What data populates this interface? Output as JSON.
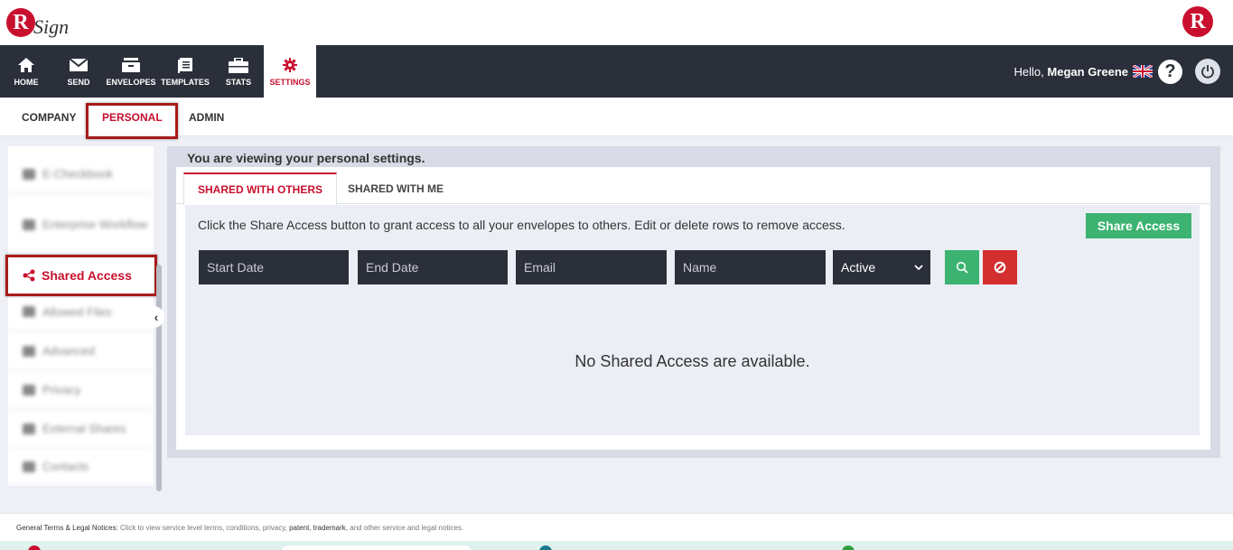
{
  "app": {
    "logo_text": "Sign",
    "logo_letter": "R"
  },
  "nav": {
    "items": [
      {
        "label": "HOME",
        "icon": "home-icon"
      },
      {
        "label": "SEND",
        "icon": "envelope-icon"
      },
      {
        "label": "ENVELOPES",
        "icon": "inbox-icon"
      },
      {
        "label": "TEMPLATES",
        "icon": "template-icon"
      },
      {
        "label": "STATS",
        "icon": "briefcase-icon"
      },
      {
        "label": "SETTINGS",
        "icon": "gear-icon",
        "active": true
      }
    ],
    "greeting": "Hello,",
    "user_name": "Megan Greene",
    "help_label": "?"
  },
  "subtabs": {
    "items": [
      "COMPANY",
      "PERSONAL",
      "ADMIN"
    ],
    "active": "PERSONAL"
  },
  "sidebar": {
    "active_item": "Shared Access",
    "blurred_items": [
      "E-Checkbook",
      "Enterprise Workflow",
      "Allowed Files",
      "Advanced",
      "Privacy",
      "External Shares",
      "Contacts"
    ]
  },
  "main": {
    "title": "You are viewing your personal settings.",
    "tabs": [
      "SHARED WITH OTHERS",
      "SHARED WITH ME"
    ],
    "active_tab": "SHARED WITH OTHERS",
    "info_text": "Click the Share Access button to grant access to all your envelopes to others. Edit or delete rows to remove access.",
    "share_button": "Share Access",
    "filters": {
      "start_date_placeholder": "Start Date",
      "end_date_placeholder": "End Date",
      "email_placeholder": "Email",
      "name_placeholder": "Name",
      "status_value": "Active"
    },
    "empty_message": "No Shared Access are available."
  },
  "footer": {
    "label": "General Terms & Legal Notices:",
    "text_1": "Click to view service level terms, conditions, privacy,",
    "patent": "patent",
    "sep": ",",
    "trademark": "trademark",
    "text_2": ", and other service and legal notices."
  },
  "colors": {
    "brand_red": "#c8102e",
    "nav_dark": "#2a2f3a",
    "success_green": "#3cb371",
    "danger_red": "#d32f2f",
    "highlight_box": "#a81b1b"
  }
}
